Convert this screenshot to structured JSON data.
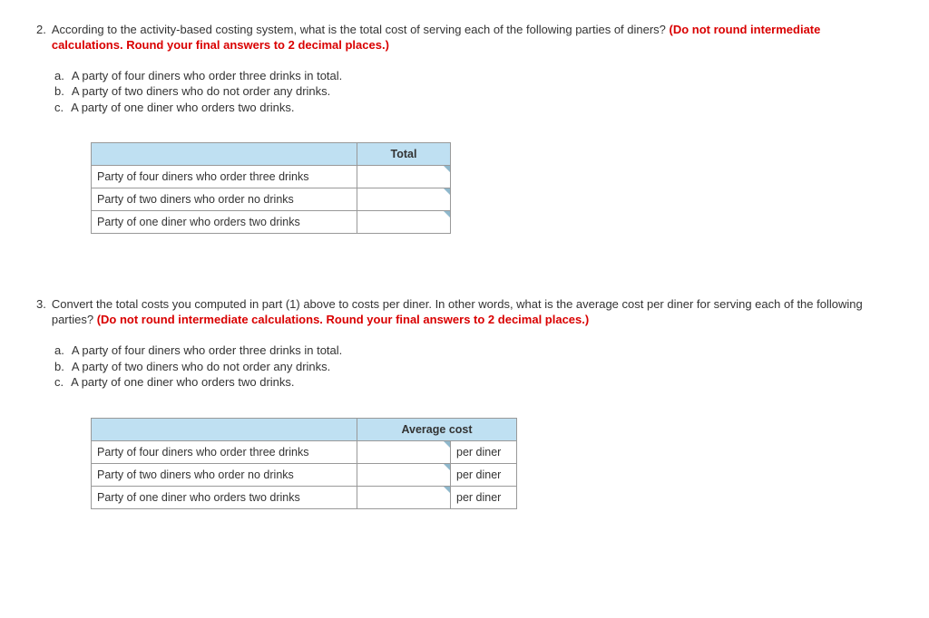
{
  "q2": {
    "number": "2.",
    "text_part1": "According to the activity-based costing system, what is the total cost of serving each of the following parties of diners? ",
    "text_red": "(Do not round intermediate calculations. Round your final answers to 2 decimal places.)",
    "subs": {
      "a": {
        "letter": "a.",
        "text": "A party of four diners who order three drinks in total."
      },
      "b": {
        "letter": "b.",
        "text": "A party of two diners who do not order any drinks."
      },
      "c": {
        "letter": "c.",
        "text": "A party of one diner who orders two drinks."
      }
    },
    "table": {
      "header": "Total",
      "rows": [
        "Party of four diners who order three drinks",
        "Party of two diners who order no drinks",
        "Party of one diner who orders two drinks"
      ]
    }
  },
  "q3": {
    "number": "3.",
    "text_part1": "Convert the total costs you computed in part (1) above to costs per diner. In other words, what is the average cost per diner for serving each of the following parties? ",
    "text_red": "(Do not round intermediate calculations. Round your final answers to 2 decimal places.)",
    "subs": {
      "a": {
        "letter": "a.",
        "text": "A party of four diners who order three drinks in total."
      },
      "b": {
        "letter": "b.",
        "text": "A party of two diners who do not order any drinks."
      },
      "c": {
        "letter": "c.",
        "text": "A party of one diner who orders two drinks."
      }
    },
    "table": {
      "header": "Average cost",
      "unit": "per diner",
      "rows": [
        "Party of four diners who order three drinks",
        "Party of two diners who order no drinks",
        "Party of one diner who orders two drinks"
      ]
    }
  }
}
